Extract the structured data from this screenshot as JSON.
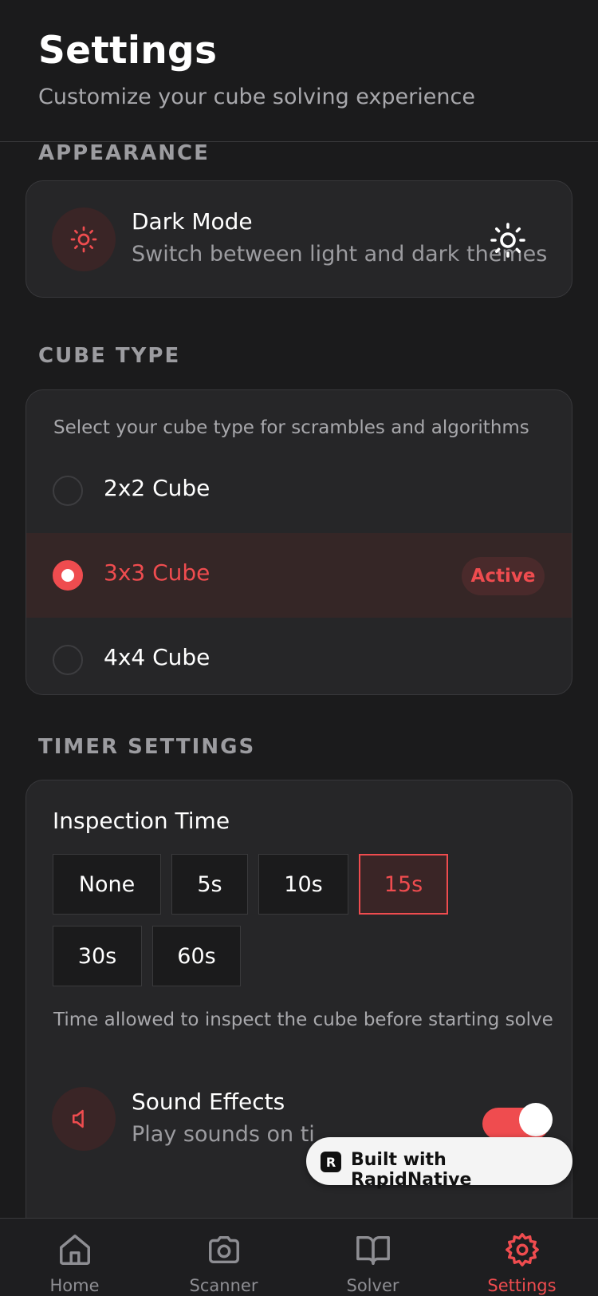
{
  "header": {
    "title": "Settings",
    "subtitle": "Customize your cube solving experience"
  },
  "appearance": {
    "section_title": "APPEARANCE",
    "dark_mode": {
      "title": "Dark Mode",
      "subtitle": "Switch between light and dark themes",
      "icon": "sun-icon",
      "toggle_icon": "sun-icon"
    }
  },
  "cube_type": {
    "section_title": "CUBE TYPE",
    "hint": "Select your cube type for scrambles and algorithms",
    "options": [
      {
        "label": "2x2 Cube",
        "selected": false
      },
      {
        "label": "3x3 Cube",
        "selected": true
      },
      {
        "label": "4x4 Cube",
        "selected": false
      }
    ],
    "active_badge": "Active"
  },
  "timer": {
    "section_title": "TIMER SETTINGS",
    "inspection_title": "Inspection Time",
    "options": [
      "None",
      "5s",
      "10s",
      "15s",
      "30s",
      "60s"
    ],
    "selected": "15s",
    "hint": "Time allowed to inspect the cube before starting solve",
    "sound": {
      "title": "Sound Effects",
      "subtitle": "Play sounds on ti",
      "icon": "speaker-icon",
      "enabled": true
    }
  },
  "watermark": {
    "text": "Built with RapidNative"
  },
  "tabs": [
    {
      "label": "Home",
      "icon": "home-icon",
      "active": false
    },
    {
      "label": "Scanner",
      "icon": "camera-icon",
      "active": false
    },
    {
      "label": "Solver",
      "icon": "book-icon",
      "active": false
    },
    {
      "label": "Settings",
      "icon": "gear-icon",
      "active": true
    }
  ],
  "colors": {
    "accent": "#ef4c4f",
    "background": "#1b1b1c",
    "card": "#262628"
  }
}
